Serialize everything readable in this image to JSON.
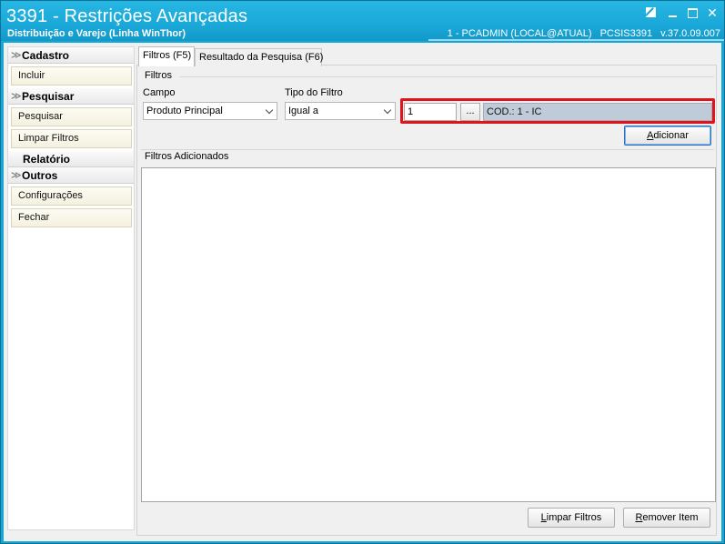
{
  "window": {
    "title": "3391 - Restrições Avançadas",
    "subtitle": "Distribuição e Varejo (Linha WinThor)",
    "user": "1 - PCADMIN (LOCAL@ATUAL)",
    "module": "PCSIS3391",
    "version": "v.37.0.09.007",
    "controls": [
      "settings-icon",
      "minimize-icon",
      "maximize-icon",
      "close-icon"
    ]
  },
  "sidebar": {
    "groups": [
      {
        "title": "Cadastro",
        "icon": "chevron-down-icon",
        "items": [
          "Incluir"
        ]
      },
      {
        "title": "Pesquisar",
        "icon": "chevron-down-icon",
        "items": [
          "Pesquisar",
          "Limpar Filtros"
        ]
      },
      {
        "title": "Relatório",
        "items": []
      },
      {
        "title": "Outros",
        "icon": "chevron-down-icon",
        "items": [
          "Configurações",
          "Fechar"
        ]
      }
    ]
  },
  "tabs": [
    {
      "label": "Filtros (F5)",
      "active": true
    },
    {
      "label": "Resultado da Pesquisa (F6)",
      "active": false
    }
  ],
  "filters": {
    "section_title": "Filtros",
    "campo_label": "Campo",
    "campo_value": "Produto Principal",
    "tipo_label": "Tipo do Filtro",
    "tipo_value": "Igual a",
    "code_value": "1",
    "lookup_label": "...",
    "description_value": "COD.: 1 - IC",
    "add_button": "Adicionar",
    "add_button_underline": "A",
    "add_button_rest": "dicionar"
  },
  "added": {
    "section_title": "Filtros Adicionados",
    "items": []
  },
  "footer": {
    "clear_underline": "L",
    "clear_rest": "impar Filtros",
    "remove_underline": "R",
    "remove_rest": "emover Item"
  },
  "colors": {
    "titlebar": "#1aa8d8",
    "highlight": "#e0141b",
    "readonly_field": "#bfcbd8"
  }
}
